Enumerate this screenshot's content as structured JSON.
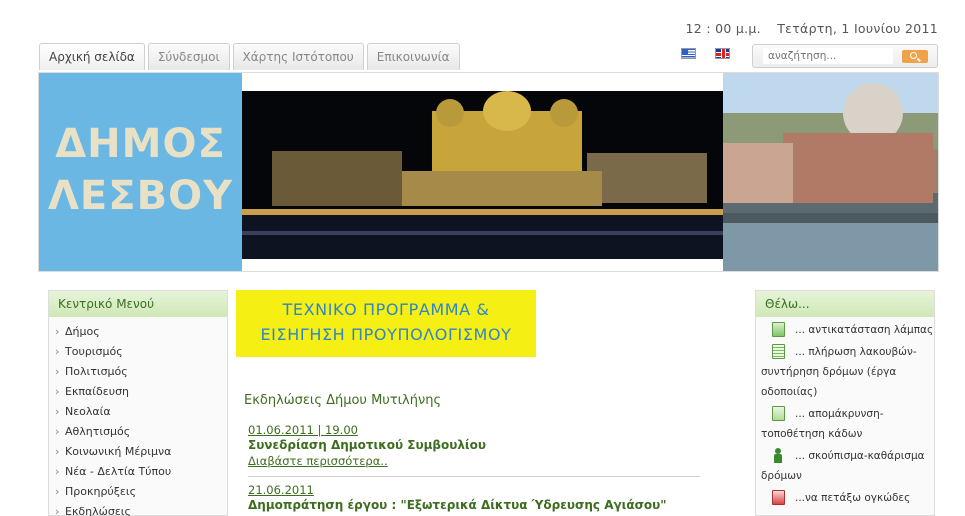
{
  "header": {
    "time": "12 : 00 μ.μ.",
    "date": "Τετάρτη, 1 Ιουνίου 2011"
  },
  "tabs": [
    {
      "label": "Αρχική σελίδα",
      "active": true
    },
    {
      "label": "Σύνδεσμοι",
      "active": false
    },
    {
      "label": "Χάρτης Ιστότοπου",
      "active": false
    },
    {
      "label": "Επικοινωνία",
      "active": false
    }
  ],
  "languages": [
    "flag-gr-icon",
    "flag-uk-icon"
  ],
  "search": {
    "placeholder": "αναζήτηση..."
  },
  "banner": {
    "logo_line1": "ΔΗΜΟΣ",
    "logo_line2": "ΛΕΣΒΟΥ"
  },
  "left_menu": {
    "title": "Κεντρικό Μενού",
    "items": [
      "Δήμος",
      "Τουρισμός",
      "Πολιτισμός",
      "Εκπαίδευση",
      "Νεολαία",
      "Αθλητισμός",
      "Κοινωνική Μέριμνα",
      "Νέα - Δελτία Τύπου",
      "Προκηρύξεις",
      "Εκδηλώσεις"
    ]
  },
  "promo": {
    "line1": "ΤΕΧΝΙΚΟ ΠΡΟΓΡΑΜΜΑ &",
    "line2": "ΕΙΣΗΓΗΣΗ ΠΡΟΥΠΟΛΟΓΙΣΜΟΥ"
  },
  "events": {
    "title": "Εκδηλώσεις Δήμου Μυτιλήνης",
    "items": [
      {
        "date": "01.06.2011 | 19.00",
        "headline": "Συνεδρίαση Δημοτικού Συμβουλίου",
        "more": "Διαβάστε περισσότερα.."
      },
      {
        "date": "21.06.2011",
        "headline": "Δημοπράτηση έργου : \"Εξωτερικά Δίκτυα Ύδρευσης Αγιάσου\""
      }
    ]
  },
  "right_menu": {
    "title": "Θέλω...",
    "items": [
      {
        "icon": "lamp-icon",
        "label": "... αντικατάσταση λάμπας"
      },
      {
        "icon": "document-icon",
        "label": "... πλήρωση λακουβών-συντήρηση δρόμων (έργα οδοποιίας)"
      },
      {
        "icon": "bin-icon",
        "label": "... απομάκρυνση-τοποθέτηση κάδων"
      },
      {
        "icon": "sweeper-icon",
        "label": "... σκούπισμα-καθάρισμα δρόμων"
      },
      {
        "icon": "bulky-items-icon",
        "label": "...να πετάξω ογκώδες"
      }
    ]
  },
  "colors": {
    "accent_green": "#3d6d1f",
    "logo_blue": "#6ab7e3",
    "promo_yellow": "#f6ef14",
    "promo_text": "#2e86c8",
    "search_button": "#f0a24a"
  }
}
